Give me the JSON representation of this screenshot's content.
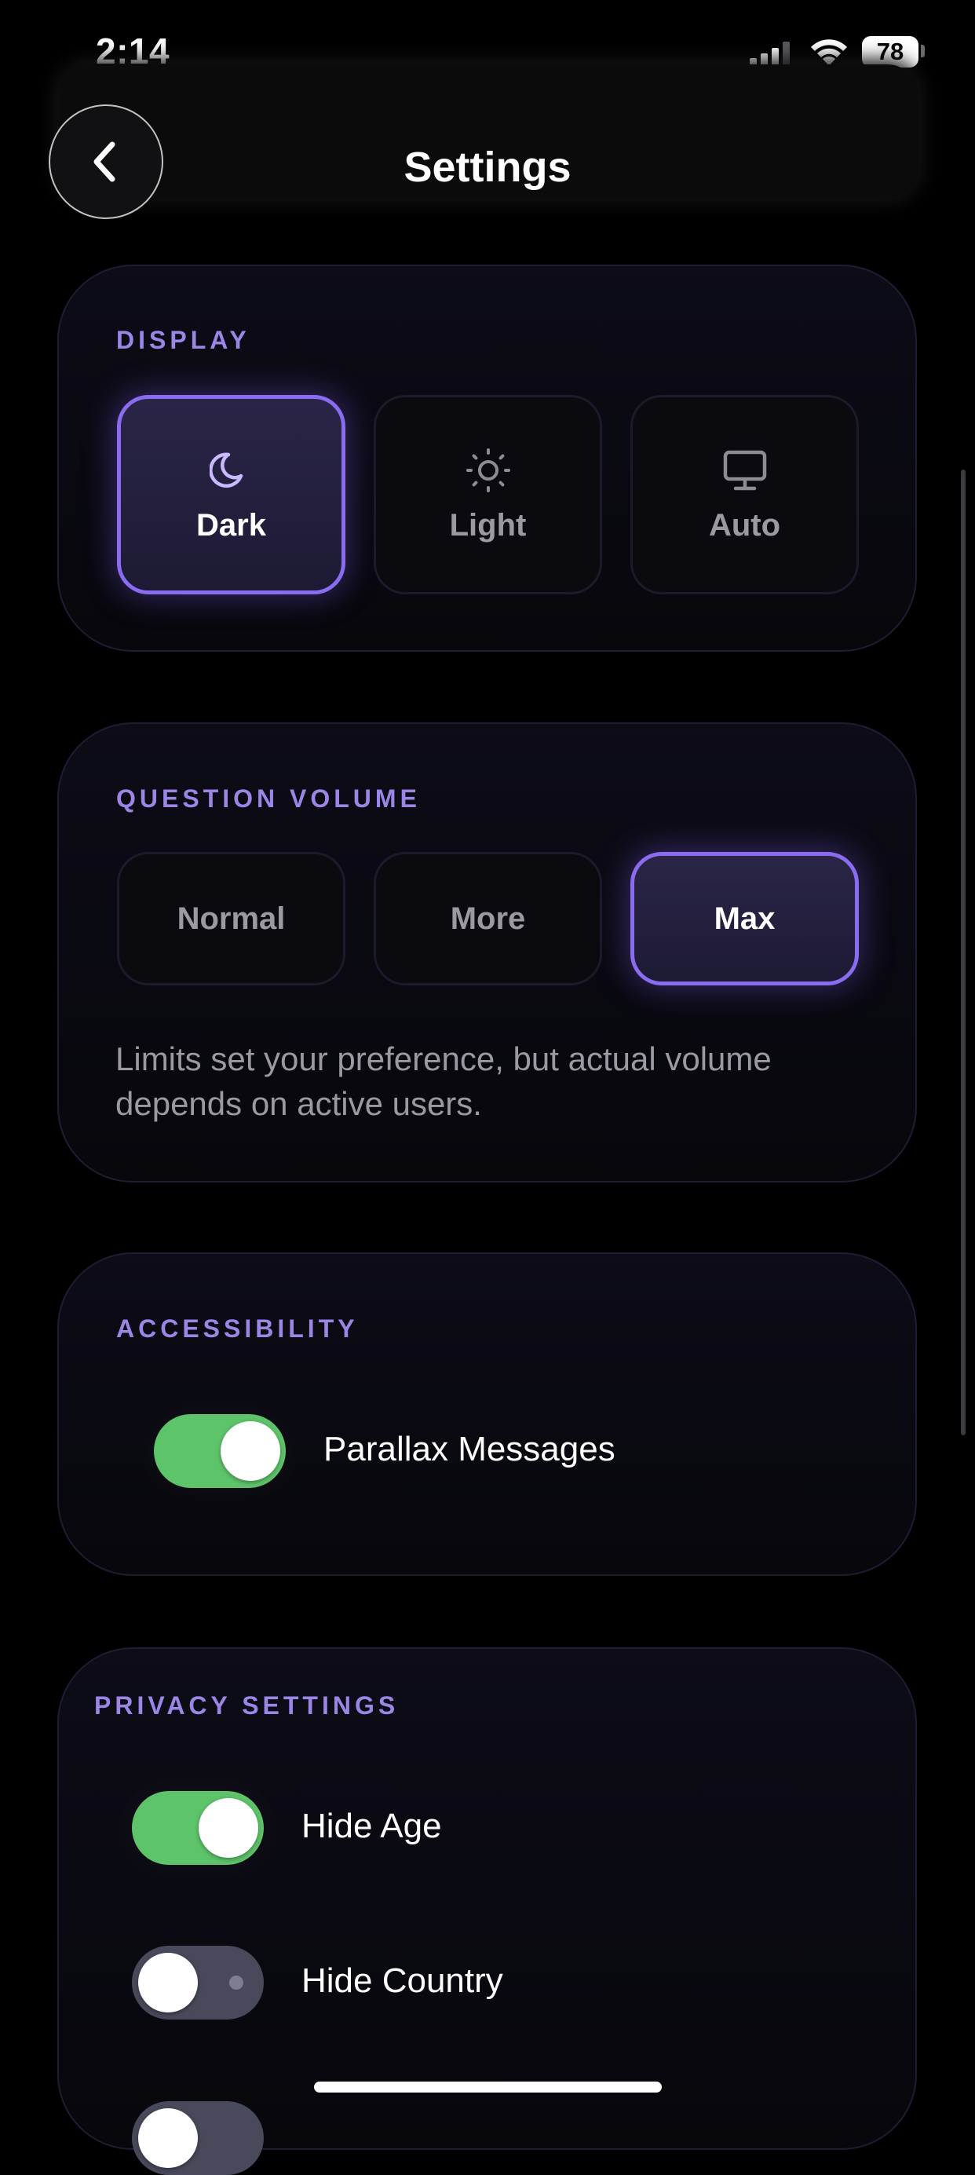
{
  "status_bar": {
    "time": "2:14",
    "battery": "78",
    "icons": [
      "signal-icon",
      "wifi-icon",
      "battery-icon"
    ]
  },
  "header": {
    "title": "Settings",
    "back_icon": "chevron-left-icon"
  },
  "display": {
    "section_label": "DISPLAY",
    "options": [
      {
        "label": "Dark",
        "icon": "moon-icon",
        "selected": true
      },
      {
        "label": "Light",
        "icon": "sun-icon",
        "selected": false
      },
      {
        "label": "Auto",
        "icon": "monitor-icon",
        "selected": false
      }
    ]
  },
  "question_volume": {
    "section_label": "QUESTION VOLUME",
    "options": [
      {
        "label": "Normal",
        "selected": false
      },
      {
        "label": "More",
        "selected": false
      },
      {
        "label": "Max",
        "selected": true
      }
    ],
    "note": "Limits set your preference, but actual volume depends on active users."
  },
  "accessibility": {
    "section_label": "ACCESSIBILITY",
    "toggles": [
      {
        "label": "Parallax Messages",
        "on": true
      }
    ]
  },
  "privacy": {
    "section_label": "PRIVACY SETTINGS",
    "toggles": [
      {
        "label": "Hide Age",
        "on": true
      },
      {
        "label": "Hide Country",
        "on": false
      }
    ]
  },
  "colors": {
    "accent": "#8b6cf0",
    "section_label": "#9b86e6",
    "toggle_on": "#5ec46a",
    "toggle_off": "#48495a",
    "background": "#000000"
  }
}
